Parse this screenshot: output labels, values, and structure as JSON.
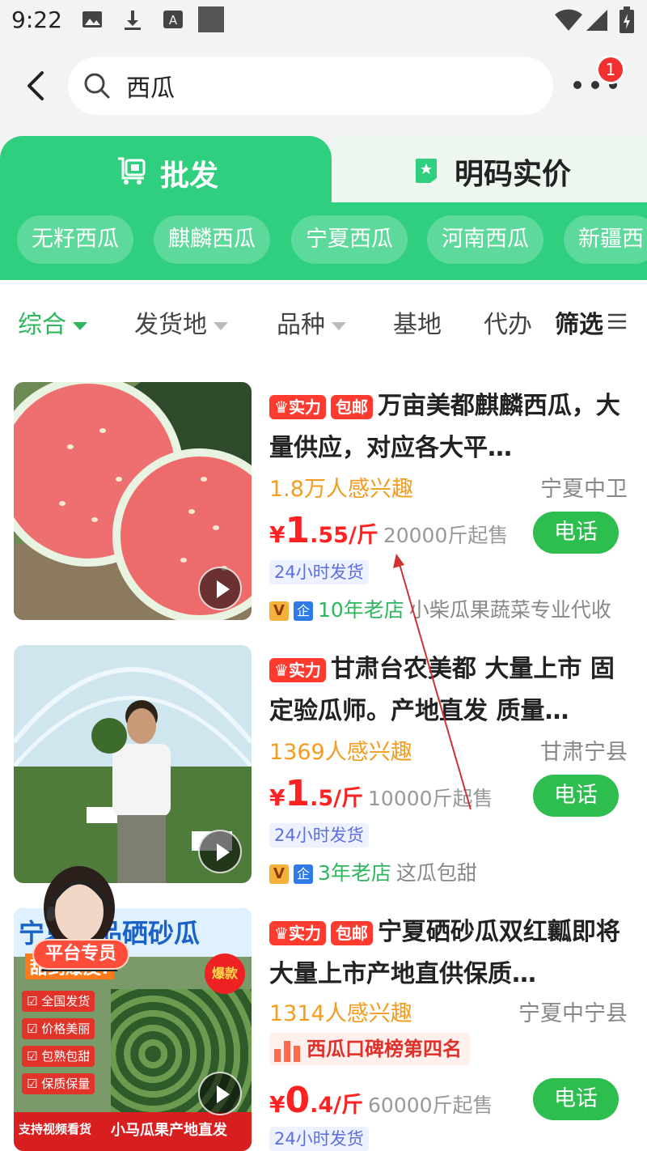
{
  "status_bar": {
    "time": "9:22"
  },
  "header": {
    "search_query": "西瓜",
    "notification_count": "1"
  },
  "tabs": [
    {
      "label": "批发",
      "active": true
    },
    {
      "label": "明码实价",
      "active": false
    }
  ],
  "chips": [
    "无籽西瓜",
    "麒麟西瓜",
    "宁夏西瓜",
    "河南西瓜",
    "新疆西"
  ],
  "filters": {
    "comprehensive": "综合",
    "origin": "发货地",
    "variety": "品种",
    "base": "基地",
    "agent": "代办",
    "filter": "筛选"
  },
  "products": [
    {
      "badges": [
        "实力",
        "包邮"
      ],
      "title": "万亩美都麒麟西瓜，大量供应，对应各大平…",
      "interest": "1.8万人感兴趣",
      "location": "宁夏中卫",
      "price_int": "1",
      "price_dec": ".55",
      "unit": "/斤",
      "min_order": "20000斤起售",
      "ship": "24小时发货",
      "store_age": "10年老店",
      "store_name": "小柴瓜果蔬菜专业代收",
      "call": "电话"
    },
    {
      "badges": [
        "实力"
      ],
      "title": "甘肃台农美都  大量上市 固定验瓜师。产地直发 质量…",
      "interest": "1369人感兴趣",
      "location": "甘肃宁县",
      "price_int": "1",
      "price_dec": ".5",
      "unit": "/斤",
      "min_order": "10000斤起售",
      "ship": "24小时发货",
      "store_age": "3年老店",
      "store_name": "这瓜包甜",
      "call": "电话"
    },
    {
      "badges": [
        "实力",
        "包邮"
      ],
      "title": "宁夏硒砂瓜双红瓤即将大量上市产地直供保质…",
      "interest": "1314人感兴趣",
      "location": "宁夏中宁县",
      "rank": "西瓜口碑榜第四名",
      "price_int": "0",
      "price_dec": ".4",
      "unit": "/斤",
      "min_order": "60000斤起售",
      "ship": "24小时发货",
      "call": "电话"
    }
  ],
  "thumb3": {
    "banner": "宁夏精品硒砂瓜",
    "subtitle": "甜到爆皮!",
    "hot": "爆款",
    "bullets": [
      "全国发货",
      "价格美丽",
      "包熟包甜",
      "保质保量"
    ],
    "footer_left": "支持视频看货",
    "footer_right": "小马瓜果产地直发"
  },
  "agent_label": "平台专员",
  "colors": {
    "brand_green": "#2fcf7f",
    "price_red": "#ff2222",
    "call_green": "#2ebd4f",
    "interest_orange": "#f39c1f"
  }
}
